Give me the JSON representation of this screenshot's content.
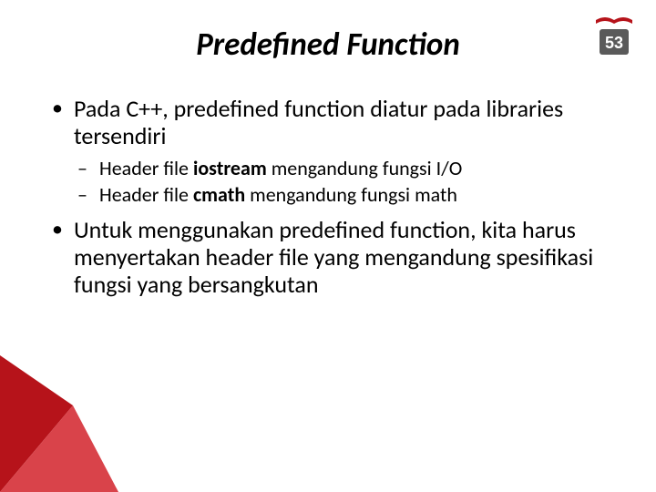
{
  "title": "Predefined Function",
  "bullets": {
    "b1": "Pada C++, predefined function diatur pada libraries tersendiri",
    "s1a": "Header file ",
    "s1b": "iostream",
    "s1c": " mengandung fungsi I/O",
    "s2a": "Header file ",
    "s2b": "cmath",
    "s2c": " mengandung fungsi math",
    "b2": "Untuk menggunakan predefined function, kita harus menyertakan header file yang mengandung spesifikasi fungsi yang bersangkutan"
  },
  "logo_text": "53"
}
